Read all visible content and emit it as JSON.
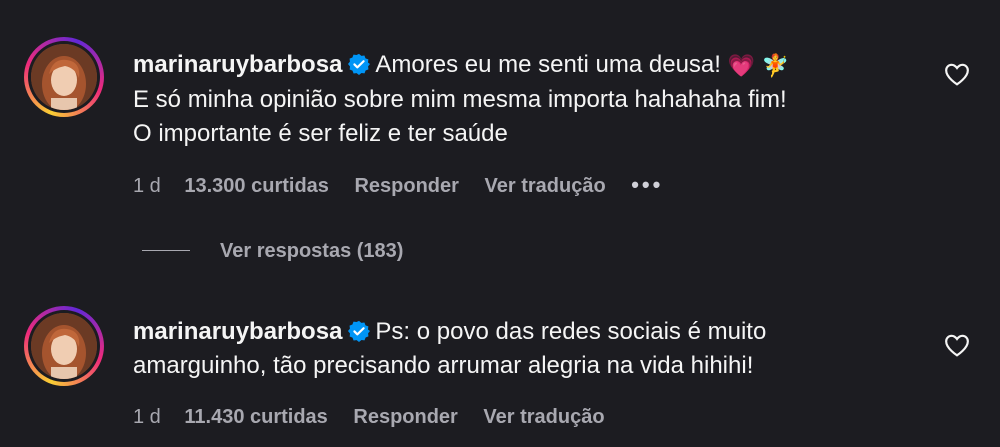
{
  "comments": [
    {
      "username": "marinaruybarbosa",
      "text_part1": "Amores eu me senti uma deusa!",
      "emoji1": "💗",
      "emoji2": "🧚",
      "line2": "E só minha opinião sobre mim mesma importa hahahaha fim!",
      "line3": "O importante é ser feliz e ter saúde",
      "time": "1 d",
      "likes": "13.300 curtidas",
      "reply": "Responder",
      "translate": "Ver tradução",
      "more": "•••"
    },
    {
      "username": "marinaruybarbosa",
      "text_line1": "Ps: o povo das redes sociais é muito",
      "text_line2": "amarguinho, tão precisando arrumar alegria na vida hihihi!",
      "time": "1 d",
      "likes": "11.430 curtidas",
      "reply": "Responder",
      "translate": "Ver tradução"
    }
  ],
  "view_replies": "Ver respostas (183)",
  "icons": {
    "verified": "verified-badge-icon",
    "like": "heart-outline-icon",
    "more": "more-options-icon"
  },
  "colors": {
    "background": "#1c1c21",
    "verified": "#0095f6",
    "meta": "#a8a8b0"
  }
}
